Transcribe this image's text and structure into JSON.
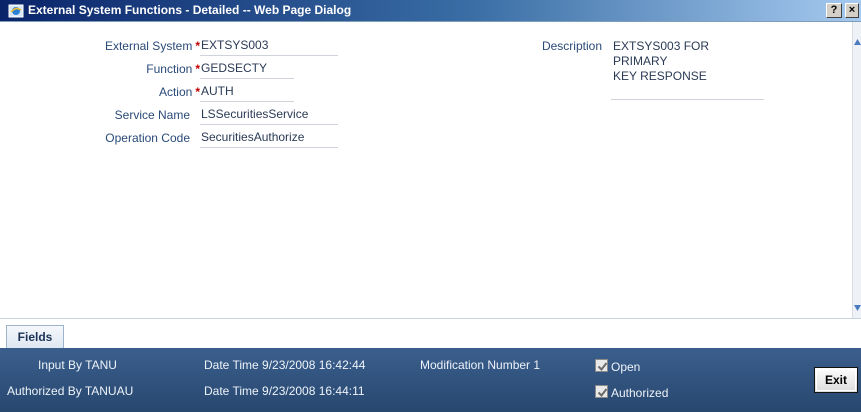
{
  "window": {
    "title": "External System Functions - Detailed -- Web Page Dialog",
    "help_label": "?",
    "close_label": "×"
  },
  "form": {
    "external_system": {
      "label": "External System",
      "required_mark": "*",
      "value": "EXTSYS003"
    },
    "function": {
      "label": "Function",
      "required_mark": "*",
      "value": "GEDSECTY"
    },
    "action": {
      "label": "Action",
      "required_mark": "*",
      "value": "AUTH"
    },
    "service_name": {
      "label": "Service Name",
      "value": "LSSecuritiesService"
    },
    "operation_code": {
      "label": "Operation Code",
      "value": "SecuritiesAuthorize"
    },
    "description": {
      "label": "Description",
      "value_line1": "EXTSYS003 FOR PRIMARY",
      "value_line2": "KEY RESPONSE"
    }
  },
  "tabs": [
    {
      "label": "Fields"
    }
  ],
  "footer": {
    "input_by": "Input By TANU",
    "authorized_by": "Authorized By TANUAU",
    "input_datetime": "Date Time 9/23/2008 16:42:44",
    "auth_datetime": "Date Time 9/23/2008 16:44:11",
    "modification_number": "Modification Number 1",
    "open_label": "Open",
    "open_checked": true,
    "authorized_label": "Authorized",
    "authorized_checked": true,
    "exit_label": "Exit"
  },
  "colors": {
    "title_bar": "#0a246a",
    "footer_bg": "#2f5480",
    "required": "#c00000"
  }
}
